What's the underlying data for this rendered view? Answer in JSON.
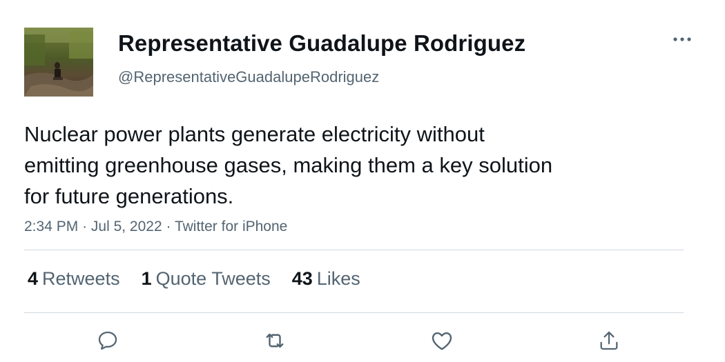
{
  "author": {
    "display_name": "Representative Guadalupe Rodriguez",
    "handle": "@RepresentativeGuadalupeRodriguez"
  },
  "tweet": {
    "lines": [
      "Nuclear power plants generate electricity without",
      "emitting greenhouse gases, making them a key solution",
      "for future generations."
    ],
    "time": "2:34 PM",
    "date": "Jul 5, 2022",
    "source": "Twitter for iPhone",
    "separator": "·"
  },
  "stats": {
    "retweets": {
      "count": "4",
      "label": "Retweets"
    },
    "quote_tweets": {
      "count": "1",
      "label": "Quote Tweets"
    },
    "likes": {
      "count": "43",
      "label": "Likes"
    }
  },
  "actions": [
    "reply-icon",
    "retweet-icon",
    "like-icon",
    "share-icon"
  ],
  "colors": {
    "primary_text": "#0f1419",
    "secondary_text": "#536471",
    "divider": "#cfd9de"
  }
}
